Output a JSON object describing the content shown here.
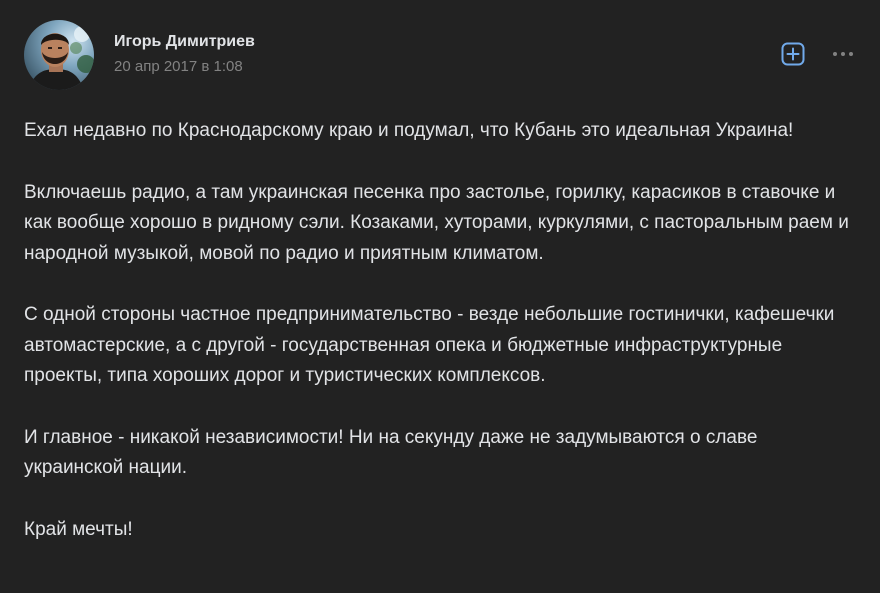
{
  "author": {
    "name": "Игорь Димитриев",
    "avatar_icon": "user-photo-avatar"
  },
  "post": {
    "date": "20 апр 2017 в 1:08",
    "paragraphs": [
      "Ехал недавно по Краснодарскому краю и подумал, что Кубань это идеальная Украина!",
      "Включаешь радио, а там украинская песенка про застолье, горилку, карасиков в ставочке и как вообще хорошо в ридному сэли. Козаками, хуторами, куркулями, с пасторальным раем и народной музыкой, мовой по радио и приятным климатом.",
      "С одной стороны частное предпринимательство - везде небольшие гостинички, кафешечки автомастерские, а с другой - государственная опека и бюджетные инфраструктурные проекты, типа хороших дорог и туристических комплексов.",
      "И главное - никакой независимости! Ни на секунду даже не задумываются о славе украинской нации.",
      "Край мечты!"
    ]
  },
  "actions": {
    "add_icon": "plus-square-icon",
    "more_icon": "more-horizontal-icon"
  },
  "colors": {
    "background": "#222222",
    "text": "#e1e3e6",
    "secondary_text": "#828282",
    "accent": "#71aaeb"
  }
}
